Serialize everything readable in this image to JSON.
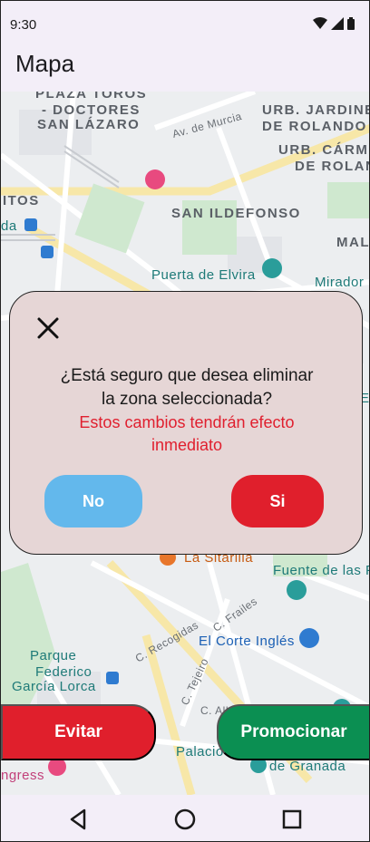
{
  "status_bar": {
    "time": "9:30"
  },
  "app_bar": {
    "title": "Mapa"
  },
  "map": {
    "labels": {
      "plaza_toros": "PLAZA TOROS",
      "doctores": "- DOCTORES",
      "san_lazaro": "SAN LÁZARO",
      "av_murcia": "Av. de Murcia",
      "urb_jardines": "URB. JARDINE",
      "de_rolando": "DE ROLANDO",
      "urb_carmen": "URB. CÁRM",
      "de_rolan": "DE ROLAN",
      "itos": "ITOS",
      "da": "da",
      "san_ildefonso": "SAN ILDEFONSO",
      "mal": "MAL",
      "puerta_elvira": "Puerta de Elvira",
      "mirador": "Mirador",
      "el": "El",
      "la_sitarilla": "La Sitarilla",
      "fuente": "Fuente de las F",
      "c_frailes": "C. Frailes",
      "c_recogidas": "C. Recogidas",
      "el_corte_ingles": "El Corte Inglés",
      "parque": "Parque",
      "federico": "Federico",
      "garcia_lorca": "García Lorca",
      "c_tejeiro": "C. Tejeiro",
      "c_alh": "C. Alh",
      "palacio": "Palacio",
      "ngress": "ngress",
      "de_granada": "de Granada"
    }
  },
  "dialog": {
    "question": "¿Está seguro que desea eliminar la zona seleccionada?",
    "warning": "Estos cambios tendrán efecto inmediato",
    "no_label": "No",
    "si_label": "Si"
  },
  "actions": {
    "evitar_label": "Evitar",
    "promocionar_label": "Promocionar"
  },
  "colors": {
    "danger": "#e01f2c",
    "info": "#63b8ec",
    "success": "#0b8f52",
    "dialog_bg": "#e6d6d6",
    "bar_bg": "#f3eef8"
  }
}
